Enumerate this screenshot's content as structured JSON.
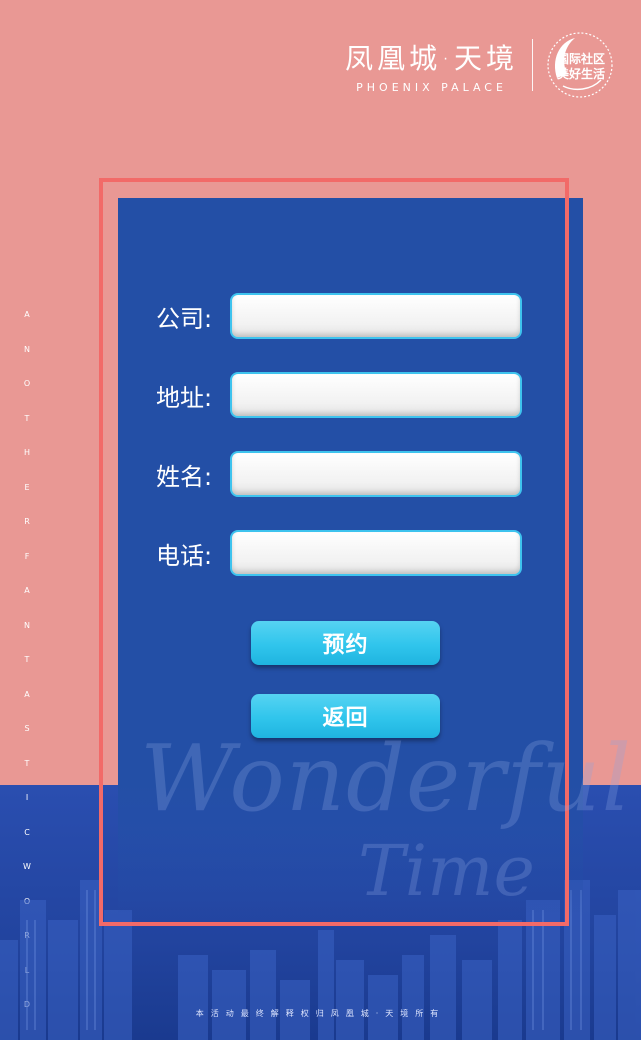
{
  "brand": {
    "name_cn": "凤凰城·天境",
    "name_en": "PHOENIX PALACE",
    "seal_lines": [
      "国际社区",
      "美好生活"
    ],
    "seal_ring_text": "INTERNATIONAL COMMUNITY"
  },
  "side_text": [
    "A",
    "N",
    "O",
    "T",
    "H",
    "E",
    "R",
    "F",
    "A",
    "N",
    "T",
    "A",
    "S",
    "T",
    "I",
    "C",
    "W",
    "O",
    "R",
    "L",
    "D"
  ],
  "form": {
    "fields": [
      {
        "label": "公司:",
        "value": "",
        "placeholder": ""
      },
      {
        "label": "地址:",
        "value": "",
        "placeholder": ""
      },
      {
        "label": "姓名:",
        "value": "",
        "placeholder": ""
      },
      {
        "label": "电话:",
        "value": "",
        "placeholder": ""
      }
    ],
    "submit_label": "预约",
    "back_label": "返回"
  },
  "watermark": {
    "line1": "Wonderful",
    "line2": "Time"
  },
  "footer": "本活动最终解释权归凤凰城·天境所有",
  "colors": {
    "pink_bg": "#e99894",
    "panel_blue": "#234fa6",
    "frame": "#f26a68",
    "button": "#30c5ec"
  }
}
